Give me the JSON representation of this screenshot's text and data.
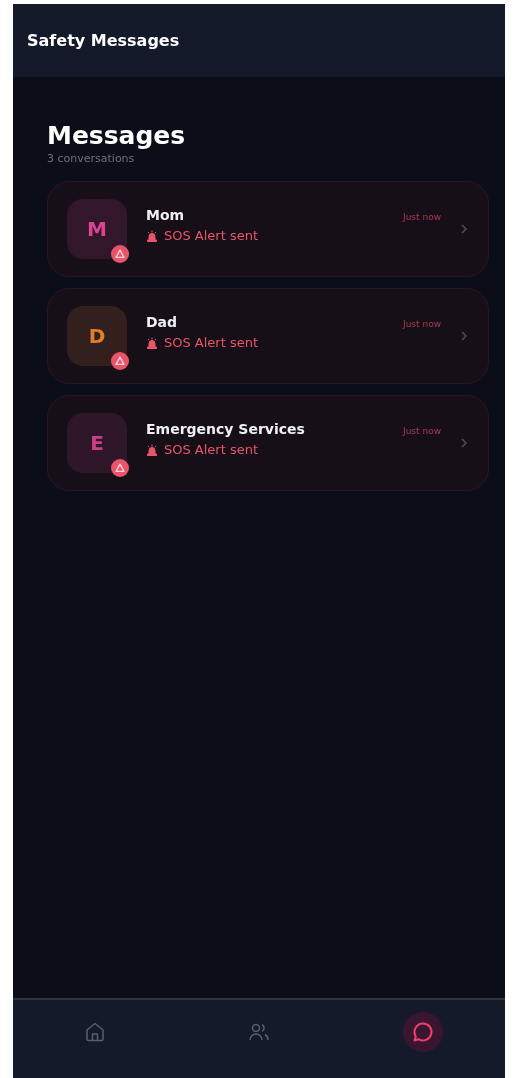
{
  "header": {
    "title": "Safety Messages"
  },
  "page": {
    "title": "Messages",
    "subtitle": "3 conversations"
  },
  "conversations": [
    {
      "initial": "M",
      "color": "#d9438f",
      "name": "Mom",
      "message": "SOS Alert sent",
      "time": "Just now"
    },
    {
      "initial": "D",
      "color": "#e0802c",
      "name": "Dad",
      "message": "SOS Alert sent",
      "time": "Just now"
    },
    {
      "initial": "E",
      "color": "#c9408a",
      "name": "Emergency Services",
      "message": "SOS Alert sent",
      "time": "Just now"
    }
  ],
  "nav": [
    {
      "kind": "home",
      "selected": false
    },
    {
      "kind": "contacts",
      "selected": false
    },
    {
      "kind": "messages",
      "selected": true
    }
  ]
}
